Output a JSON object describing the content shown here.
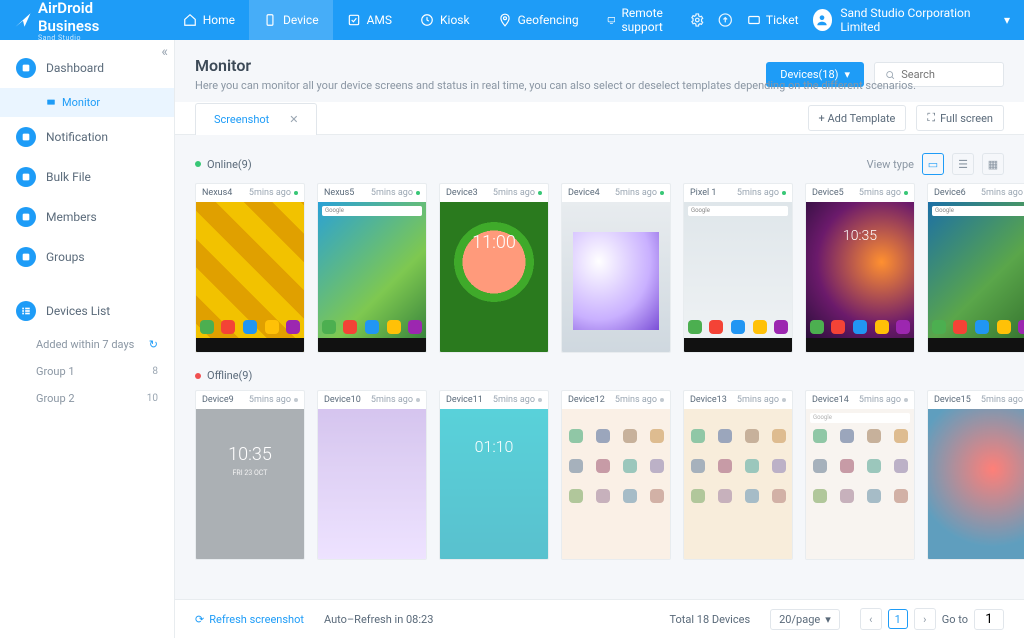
{
  "brand": {
    "name": "AirDroid Business",
    "sub": "Sand Studio"
  },
  "topnav": [
    {
      "label": "Home",
      "icon": "home"
    },
    {
      "label": "Device",
      "icon": "device",
      "active": true
    },
    {
      "label": "AMS",
      "icon": "ams"
    },
    {
      "label": "Kiosk",
      "icon": "kiosk"
    },
    {
      "label": "Geofencing",
      "icon": "geo"
    },
    {
      "label": "Remote support",
      "icon": "support"
    }
  ],
  "topright": {
    "ticket": "Ticket",
    "user": "Sand Studio Corporation Limited"
  },
  "sidebar": {
    "items": [
      {
        "label": "Dashboard",
        "icon": "dashboard"
      },
      {
        "label": "Monitor",
        "sub": true,
        "active": true
      },
      {
        "label": "Notification",
        "icon": "bell"
      },
      {
        "label": "Bulk File",
        "icon": "file"
      },
      {
        "label": "Members",
        "icon": "members"
      },
      {
        "label": "Groups",
        "icon": "groups"
      }
    ],
    "devicesListTitle": "Devices List",
    "devicesList": [
      {
        "label": "Added within 7 days",
        "badge": "↻"
      },
      {
        "label": "Group 1",
        "badge": "8"
      },
      {
        "label": "Group 2",
        "badge": "10"
      }
    ]
  },
  "page": {
    "title": "Monitor",
    "desc": "Here you can monitor all your device screens and status in real time, you can also select or deselect templates depending on the different scenarios.",
    "devicesBtn": "Devices(18)",
    "searchPlaceholder": "Search"
  },
  "tabs": {
    "active": "Screenshot",
    "addTemplate": "+ Add Template",
    "fullscreen": "Full screen"
  },
  "sections": {
    "onlineLabel": "Online(9)",
    "offlineLabel": "Offline(9)",
    "viewTypeLabel": "View type"
  },
  "online": [
    {
      "name": "Nexus4",
      "time": "5mins ago",
      "skin": "screen-nexus4"
    },
    {
      "name": "Nexus5",
      "time": "5mins ago",
      "skin": "screen-nexus5"
    },
    {
      "name": "Device3",
      "time": "5mins ago",
      "skin": "screen-device3",
      "clock": "11:00"
    },
    {
      "name": "Device4",
      "time": "5mins ago",
      "skin": "screen-device4"
    },
    {
      "name": "Pixel 1",
      "time": "5mins ago",
      "skin": "screen-pixel"
    },
    {
      "name": "Device5",
      "time": "5mins ago",
      "skin": "screen-device5",
      "clock": "10:35"
    },
    {
      "name": "Device6",
      "time": "5mins ago",
      "skin": "screen-device6"
    }
  ],
  "offline": [
    {
      "name": "Device9",
      "time": "5mins ago",
      "skin": "screen-d9",
      "clock": "10:35",
      "date": "FRI 23 OCT"
    },
    {
      "name": "Device10",
      "time": "5mins ago",
      "skin": "screen-d10"
    },
    {
      "name": "Device11",
      "time": "5mins ago",
      "skin": "screen-d11",
      "clock": "01:10"
    },
    {
      "name": "Device12",
      "time": "5mins ago",
      "skin": "screen-d12"
    },
    {
      "name": "Device13",
      "time": "5mins ago",
      "skin": "screen-d13"
    },
    {
      "name": "Device14",
      "time": "5mins ago",
      "skin": "screen-d14"
    },
    {
      "name": "Device15",
      "time": "5mins ago",
      "skin": "screen-d15"
    }
  ],
  "footer": {
    "refresh": "Refresh screenshot",
    "autoRefresh": "Auto–Refresh in 08:23",
    "total": "Total 18 Devices",
    "perPage": "20/page",
    "currentPage": "1",
    "gotoLabel": "Go to",
    "gotoValue": "1"
  }
}
